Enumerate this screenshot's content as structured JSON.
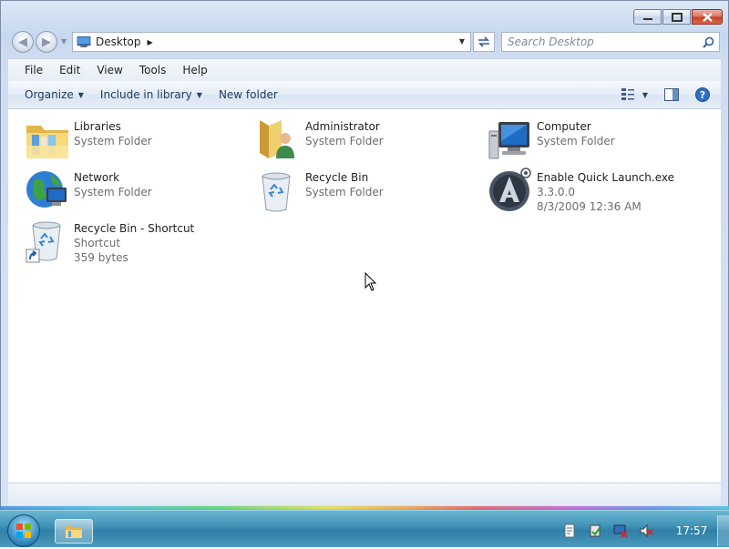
{
  "address": {
    "location": "Desktop",
    "search_placeholder": "Search Desktop"
  },
  "menu": [
    "File",
    "Edit",
    "View",
    "Tools",
    "Help"
  ],
  "toolbar": {
    "organize": "Organize",
    "include_in_library": "Include in library",
    "new_folder": "New folder"
  },
  "items": [
    {
      "name": "Libraries",
      "lines": [
        "System Folder"
      ],
      "icon": "libraries-icon"
    },
    {
      "name": "Administrator",
      "lines": [
        "System Folder"
      ],
      "icon": "user-folder-icon"
    },
    {
      "name": "Computer",
      "lines": [
        "System Folder"
      ],
      "icon": "computer-icon"
    },
    {
      "name": "Network",
      "lines": [
        "System Folder"
      ],
      "icon": "network-icon"
    },
    {
      "name": "Recycle Bin",
      "lines": [
        "System Folder"
      ],
      "icon": "recycle-bin-icon"
    },
    {
      "name": "Enable Quick Launch.exe",
      "lines": [
        "3.3.0.0",
        "8/3/2009 12:36 AM"
      ],
      "icon": "app-exe-icon"
    },
    {
      "name": "Recycle Bin - Shortcut",
      "lines": [
        "Shortcut",
        "359 bytes"
      ],
      "icon": "recycle-bin-shortcut-icon"
    }
  ],
  "taskbar": {
    "clock": "17:57"
  },
  "colors": {
    "accent": "#3c8fb4",
    "window_frame": "#c6d7ee",
    "close_button": "#c63e27"
  }
}
